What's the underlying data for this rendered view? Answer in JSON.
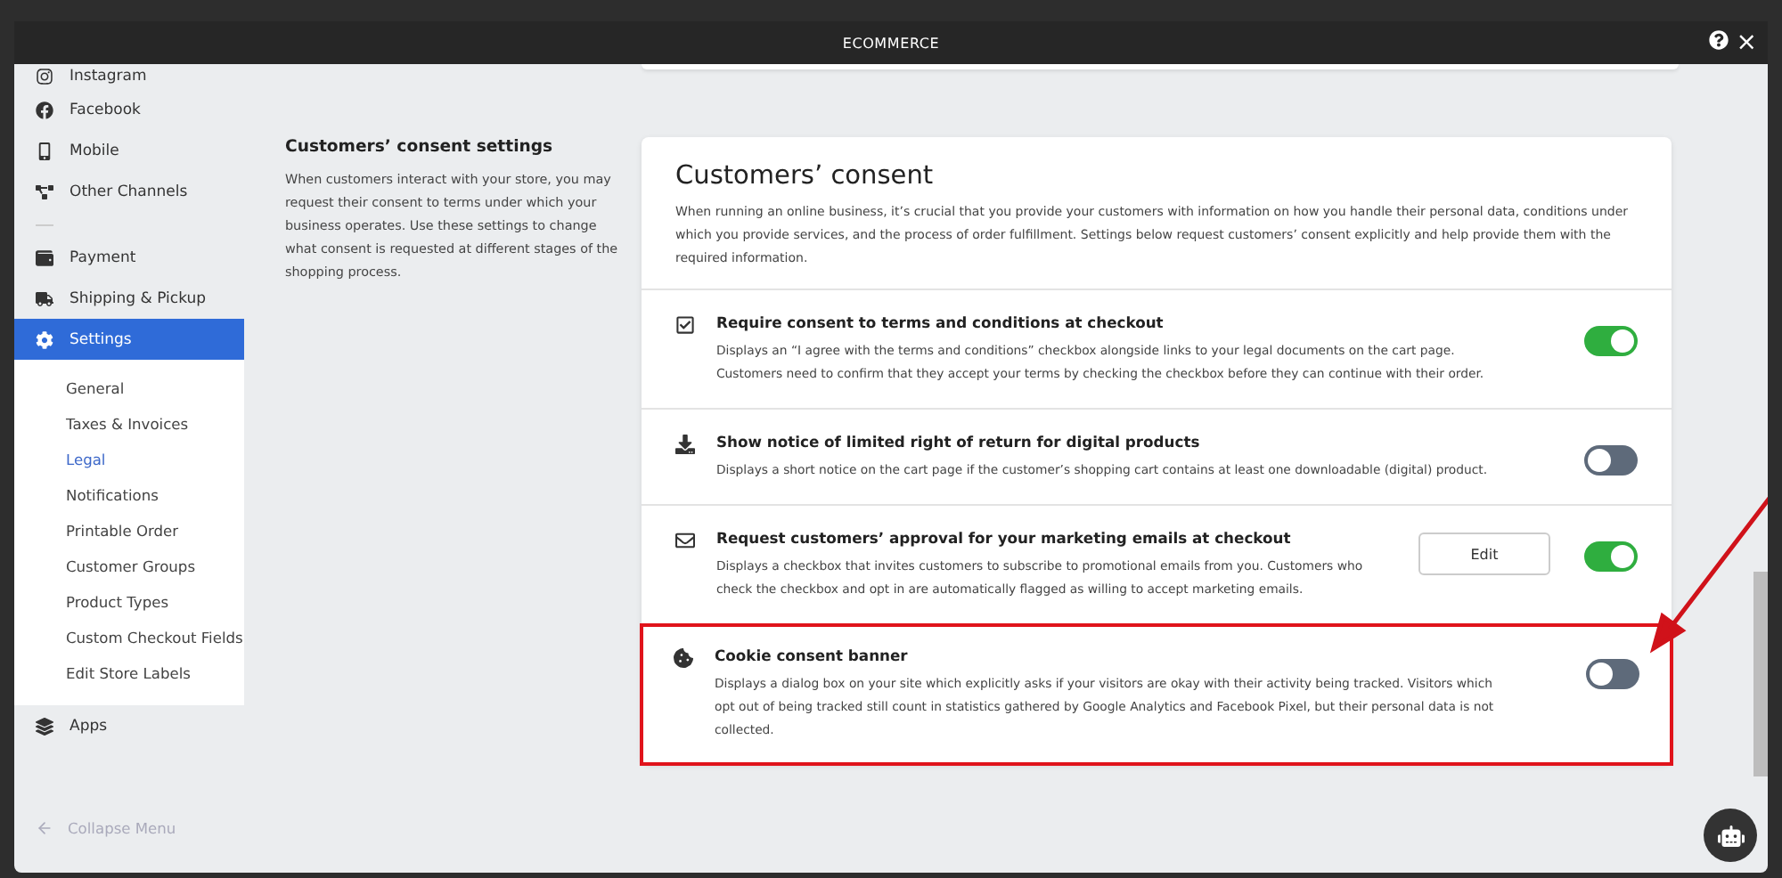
{
  "window": {
    "title": "ECOMMERCE",
    "close": "×"
  },
  "sidebar": {
    "items": [
      {
        "label": "Instagram",
        "kind": "channel",
        "selected": false
      },
      {
        "label": "Facebook",
        "kind": "channel",
        "selected": false
      },
      {
        "label": "Mobile",
        "kind": "channel",
        "selected": false
      },
      {
        "label": "Other Channels",
        "kind": "channel",
        "selected": false
      },
      {
        "kind": "divider"
      },
      {
        "label": "Payment",
        "kind": "channel",
        "selected": false
      },
      {
        "label": "Shipping & Pickup",
        "kind": "channel",
        "selected": false
      },
      {
        "label": "Settings",
        "kind": "channel",
        "selected": true,
        "children": [
          {
            "label": "General",
            "selected": false
          },
          {
            "label": "Taxes & Invoices",
            "selected": false
          },
          {
            "label": "Legal",
            "selected": true
          },
          {
            "label": "Notifications",
            "selected": false
          },
          {
            "label": "Printable Order",
            "selected": false
          },
          {
            "label": "Customer Groups",
            "selected": false
          },
          {
            "label": "Product Types",
            "selected": false
          },
          {
            "label": "Custom Checkout Fields",
            "selected": false
          },
          {
            "label": "Edit Store Labels",
            "selected": false
          }
        ]
      },
      {
        "label": "Apps",
        "kind": "channel",
        "selected": false
      }
    ],
    "collapse": "Collapse Menu"
  },
  "section": {
    "title": "Customers’ consent settings",
    "description": "When customers interact with your store, you may request their consent to terms under which your business operates. Use these settings to change what consent is requested at different stages of the shopping process."
  },
  "card": {
    "title": "Customers’ consent",
    "description": "When running an online business, it’s crucial that you provide your customers with information on how you handle their personal data, conditions under which you provide services, and the process of order fulfillment. Settings below request customers’ consent explicitly and help provide them with the required information.",
    "rows": [
      {
        "title": "Require consent to terms and conditions at checkout",
        "description": "Displays an “I agree with the terms and conditions” checkbox alongside links to your legal documents on the cart page. Customers need to confirm that they accept your terms by checking the checkbox before they can continue with their order.",
        "on": true,
        "highlighted": false
      },
      {
        "title": "Show notice of limited right of return for digital products",
        "description": "Displays a short notice on the cart page if the customer’s shopping cart contains at least one downloadable (digital) product.",
        "on": false,
        "highlighted": false
      },
      {
        "title": "Request customers’ approval for your marketing emails at checkout",
        "description": "Displays a checkbox that invites customers to subscribe to promotional emails from you. Customers who check the checkbox and opt in are automatically flagged as willing to accept marketing emails.",
        "button": "Edit",
        "on": true,
        "highlighted": false
      },
      {
        "title": "Cookie consent banner",
        "description": "Displays a dialog box on your site which explicitly asks if your visitors are okay with their activity being tracked. Visitors which opt out of being tracked still count in statistics gathered by Google Analytics and Facebook Pixel, but their personal data is not collected.",
        "on": false,
        "highlighted": true
      }
    ]
  }
}
